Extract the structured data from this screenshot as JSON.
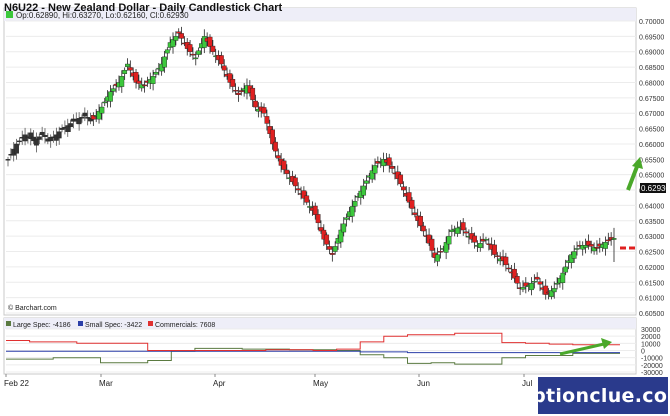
{
  "title": "N6U22 - New Zealand Dollar - Daily Candlestick Chart",
  "ohlc_label": "Op:0.62890, Hi:0.63270, Lo:0.62160, Cl:0.62930",
  "source": "© Barchart.com",
  "watermark": "optionclue.com",
  "last_price_label": "0.62930",
  "colors": {
    "up": "#3cc83c",
    "down": "#e02020",
    "large_spec": "#5a7a40",
    "small_spec": "#2b3fa8",
    "commercials": "#e03030",
    "arrow": "#4aa82a",
    "support": "#e02020",
    "watermark_bg": "#2a3a8c"
  },
  "x_labels": [
    "Feb 22",
    "Mar",
    "Apr",
    "May",
    "Jun",
    "Jul"
  ],
  "chart_data": [
    {
      "type": "candlestick",
      "title": "N6U22 - New Zealand Dollar - Daily Candlestick Chart",
      "ylim": [
        0.605,
        0.7
      ],
      "y_ticks": [
        "0.70000",
        "0.69500",
        "0.69000",
        "0.68500",
        "0.68000",
        "0.67500",
        "0.67000",
        "0.66500",
        "0.66000",
        "0.65500",
        "0.65000",
        "0.64500",
        "0.64000",
        "0.63500",
        "0.63000",
        "0.62500",
        "0.62000",
        "0.61500",
        "0.61000",
        "0.60500"
      ],
      "last": {
        "open": 0.6289,
        "high": 0.6327,
        "low": 0.6216,
        "close": 0.6293
      },
      "path": [
        [
          0,
          0.655
        ],
        [
          3,
          0.66
        ],
        [
          6,
          0.663
        ],
        [
          9,
          0.661
        ],
        [
          12,
          0.663
        ],
        [
          15,
          0.661
        ],
        [
          18,
          0.664
        ],
        [
          21,
          0.666
        ],
        [
          24,
          0.668
        ],
        [
          27,
          0.669
        ],
        [
          30,
          0.668
        ],
        [
          33,
          0.672
        ],
        [
          36,
          0.677
        ],
        [
          39,
          0.68
        ],
        [
          42,
          0.686
        ],
        [
          45,
          0.68
        ],
        [
          48,
          0.679
        ],
        [
          51,
          0.682
        ],
        [
          54,
          0.686
        ],
        [
          57,
          0.693
        ],
        [
          60,
          0.696
        ],
        [
          63,
          0.691
        ],
        [
          66,
          0.688
        ],
        [
          69,
          0.695
        ],
        [
          72,
          0.69
        ],
        [
          75,
          0.686
        ],
        [
          78,
          0.68
        ],
        [
          81,
          0.676
        ],
        [
          84,
          0.679
        ],
        [
          87,
          0.672
        ],
        [
          90,
          0.67
        ],
        [
          93,
          0.66
        ],
        [
          96,
          0.653
        ],
        [
          99,
          0.649
        ],
        [
          102,
          0.645
        ],
        [
          105,
          0.641
        ],
        [
          108,
          0.637
        ],
        [
          111,
          0.629
        ],
        [
          114,
          0.624
        ],
        [
          117,
          0.632
        ],
        [
          120,
          0.638
        ],
        [
          123,
          0.643
        ],
        [
          126,
          0.648
        ],
        [
          129,
          0.653
        ],
        [
          132,
          0.655
        ],
        [
          135,
          0.652
        ],
        [
          138,
          0.647
        ],
        [
          141,
          0.641
        ],
        [
          144,
          0.635
        ],
        [
          147,
          0.63
        ],
        [
          150,
          0.623
        ],
        [
          153,
          0.626
        ],
        [
          156,
          0.632
        ],
        [
          159,
          0.633
        ],
        [
          162,
          0.63
        ],
        [
          165,
          0.627
        ],
        [
          168,
          0.629
        ],
        [
          171,
          0.624
        ],
        [
          174,
          0.622
        ],
        [
          177,
          0.618
        ],
        [
          180,
          0.613
        ],
        [
          183,
          0.614
        ],
        [
          186,
          0.616
        ],
        [
          189,
          0.611
        ],
        [
          192,
          0.613
        ],
        [
          195,
          0.618
        ],
        [
          198,
          0.624
        ],
        [
          201,
          0.627
        ],
        [
          204,
          0.627
        ],
        [
          207,
          0.626
        ],
        [
          210,
          0.628
        ],
        [
          213,
          0.6293
        ]
      ]
    },
    {
      "type": "line",
      "title": "",
      "ylim": [
        -30000,
        30000
      ],
      "y_ticks": [
        "30000",
        "20000",
        "10000",
        "0",
        "-10000",
        "-20000",
        "-30000"
      ],
      "series": [
        {
          "name": "Large Spec: -4186",
          "color_key": "large_spec",
          "values": [
            -12000,
            -12000,
            -10000,
            -10000,
            -17000,
            -17000,
            -14000,
            -1000,
            3000,
            3000,
            2000,
            2000,
            1000,
            1000,
            0,
            -6000,
            -10000,
            -18000,
            -17000,
            -19000,
            -19000,
            -10000,
            -7000,
            -7000,
            -4000,
            -4000
          ]
        },
        {
          "name": "Small Spec: -3422",
          "color_key": "small_spec",
          "values": [
            -1000,
            -1000,
            -1000,
            -1000,
            -1000,
            -1000,
            -1000,
            -1000,
            -1000,
            -1000,
            -1000,
            -1000,
            -1000,
            -1000,
            -1000,
            -2000,
            -2000,
            -3000,
            -3000,
            -3000,
            -3000,
            -3000,
            -3000,
            -3000,
            -3000,
            -3000
          ]
        },
        {
          "name": "Commercials: 7608",
          "color_key": "commercials",
          "values": [
            14000,
            12000,
            12000,
            10000,
            10000,
            10000,
            0,
            0,
            0,
            0,
            0,
            1000,
            1000,
            0,
            2000,
            12000,
            20000,
            22000,
            22000,
            24000,
            24000,
            11000,
            10000,
            9000,
            8000,
            8000
          ]
        }
      ]
    }
  ]
}
